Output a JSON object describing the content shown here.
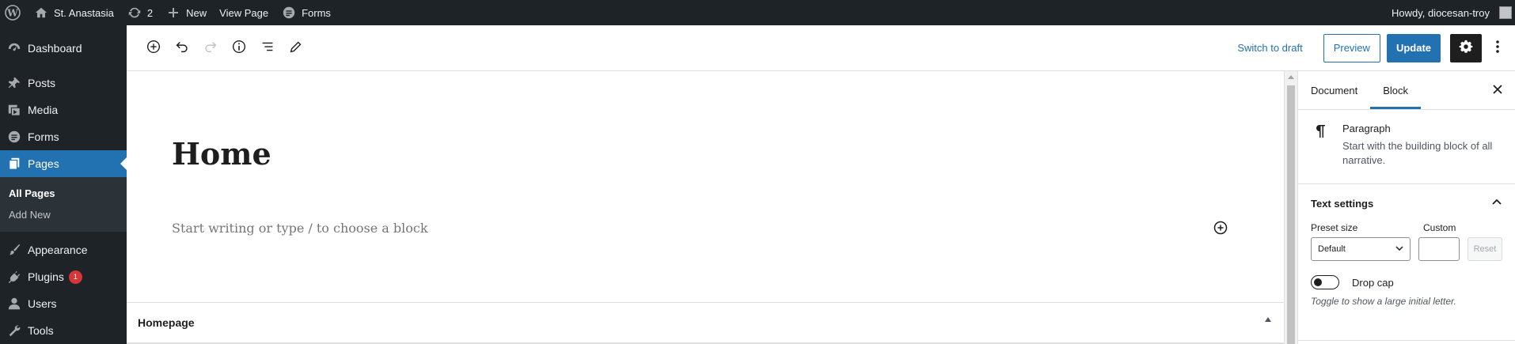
{
  "admin_bar": {
    "site_name": "St. Anastasia",
    "updates_count": "2",
    "new_label": "New",
    "view_page_label": "View Page",
    "forms_label": "Forms",
    "howdy": "Howdy, diocesan-troy"
  },
  "sidebar": {
    "items": [
      {
        "label": "Dashboard",
        "icon": "dashboard-icon"
      },
      {
        "label": "Posts",
        "icon": "pin-icon"
      },
      {
        "label": "Media",
        "icon": "media-icon"
      },
      {
        "label": "Forms",
        "icon": "forms-icon"
      },
      {
        "label": "Pages",
        "icon": "pages-icon"
      },
      {
        "label": "Appearance",
        "icon": "paintbrush-icon"
      },
      {
        "label": "Plugins",
        "icon": "plugin-icon",
        "badge": "1"
      },
      {
        "label": "Users",
        "icon": "user-icon"
      },
      {
        "label": "Tools",
        "icon": "wrench-icon"
      }
    ],
    "submenu": {
      "all_pages": "All Pages",
      "add_new": "Add New"
    },
    "colors": {
      "background": "#1d2327",
      "active": "#2271b1",
      "badge": "#d63638"
    }
  },
  "toolbar": {
    "switch_to_draft": "Switch to draft",
    "preview": "Preview",
    "update": "Update"
  },
  "editor": {
    "title": "Home",
    "placeholder": "Start writing or type / to choose a block",
    "meta_box_title": "Homepage"
  },
  "settings_sidebar": {
    "tabs": [
      "Document",
      "Block"
    ],
    "active_tab": "Block",
    "block_name": "Paragraph",
    "block_description": "Start with the building block of all narrative.",
    "text_settings_title": "Text settings",
    "preset_size_label": "Preset size",
    "preset_size_value": "Default",
    "custom_label": "Custom",
    "reset_label": "Reset",
    "drop_cap_label": "Drop cap",
    "drop_cap_help": "Toggle to show a large initial letter."
  }
}
